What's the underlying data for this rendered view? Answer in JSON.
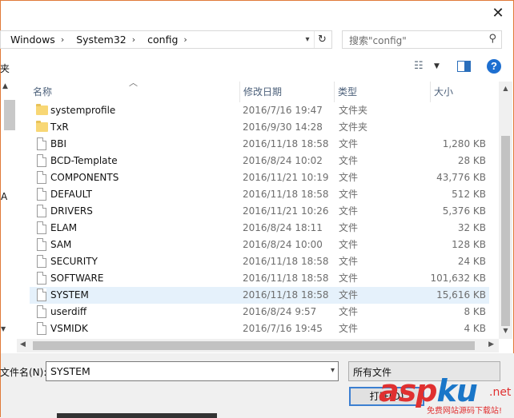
{
  "dialog": {
    "close_glyph": "✕"
  },
  "address": {
    "crumbs": [
      "Windows",
      "System32",
      "config"
    ],
    "separator": "›"
  },
  "search": {
    "placeholder": "搜索\"config\""
  },
  "toolbar": {
    "left_fragment": "夹"
  },
  "nav": {
    "letter_fragment": "A"
  },
  "columns": {
    "name": "名称",
    "date": "修改日期",
    "type": "类型",
    "size": "大小"
  },
  "files": [
    {
      "name": "systemprofile",
      "date": "2016/7/16 19:47",
      "type": "文件夹",
      "size": "",
      "kind": "folder"
    },
    {
      "name": "TxR",
      "date": "2016/9/30 14:28",
      "type": "文件夹",
      "size": "",
      "kind": "folder"
    },
    {
      "name": "BBI",
      "date": "2016/11/18 18:58",
      "type": "文件",
      "size": "1,280 KB",
      "kind": "file"
    },
    {
      "name": "BCD-Template",
      "date": "2016/8/24 10:02",
      "type": "文件",
      "size": "28 KB",
      "kind": "file"
    },
    {
      "name": "COMPONENTS",
      "date": "2016/11/21 10:19",
      "type": "文件",
      "size": "43,776 KB",
      "kind": "file"
    },
    {
      "name": "DEFAULT",
      "date": "2016/11/18 18:58",
      "type": "文件",
      "size": "512 KB",
      "kind": "file"
    },
    {
      "name": "DRIVERS",
      "date": "2016/11/21 10:26",
      "type": "文件",
      "size": "5,376 KB",
      "kind": "file"
    },
    {
      "name": "ELAM",
      "date": "2016/8/24 18:11",
      "type": "文件",
      "size": "32 KB",
      "kind": "file"
    },
    {
      "name": "SAM",
      "date": "2016/8/24 10:00",
      "type": "文件",
      "size": "128 KB",
      "kind": "file"
    },
    {
      "name": "SECURITY",
      "date": "2016/11/18 18:58",
      "type": "文件",
      "size": "24 KB",
      "kind": "file"
    },
    {
      "name": "SOFTWARE",
      "date": "2016/11/18 18:58",
      "type": "文件",
      "size": "101,632 KB",
      "kind": "file"
    },
    {
      "name": "SYSTEM",
      "date": "2016/11/18 18:58",
      "type": "文件",
      "size": "15,616 KB",
      "kind": "file",
      "selected": true
    },
    {
      "name": "userdiff",
      "date": "2016/8/24 9:57",
      "type": "文件",
      "size": "8 KB",
      "kind": "file"
    },
    {
      "name": "VSMIDK",
      "date": "2016/7/16 19:45",
      "type": "文件",
      "size": "4 KB",
      "kind": "file"
    }
  ],
  "filename": {
    "label": "文件名(N):",
    "value": "SYSTEM"
  },
  "filetype": {
    "value": "所有文件"
  },
  "open_button": {
    "label": "打开(O)"
  },
  "watermark": {
    "logo_a": "asp",
    "logo_k": "ku",
    "net": ".net",
    "sub": "免费网站源码下载站!"
  },
  "colors": {
    "accent": "#1e6fd0",
    "selection": "#e5f1fb",
    "window_border": "#e07a39"
  }
}
